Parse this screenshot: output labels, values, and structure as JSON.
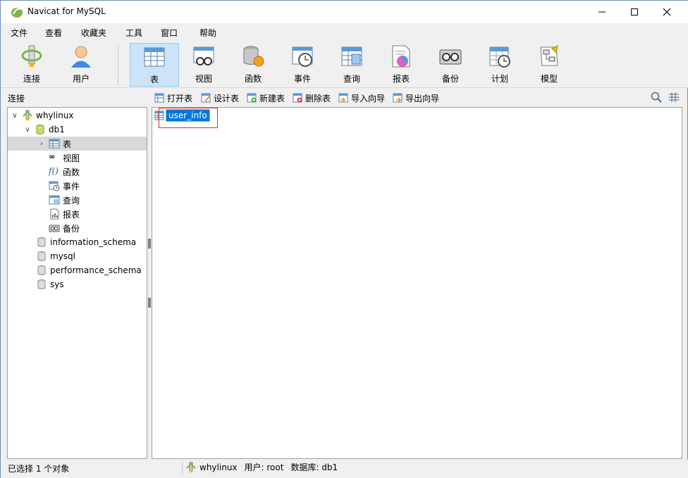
{
  "window": {
    "title": "Navicat for MySQL"
  },
  "menu": [
    "文件",
    "查看",
    "收藏夹",
    "工具",
    "窗口",
    "帮助"
  ],
  "toolbar": [
    {
      "label": "连接",
      "icon": "connection-icon"
    },
    {
      "label": "用户",
      "icon": "user-icon"
    },
    {
      "label": "表",
      "icon": "table-icon",
      "active": true
    },
    {
      "label": "视图",
      "icon": "view-icon"
    },
    {
      "label": "函数",
      "icon": "function-icon"
    },
    {
      "label": "事件",
      "icon": "event-icon"
    },
    {
      "label": "查询",
      "icon": "query-icon"
    },
    {
      "label": "报表",
      "icon": "report-icon"
    },
    {
      "label": "备份",
      "icon": "backup-icon"
    },
    {
      "label": "计划",
      "icon": "schedule-icon"
    },
    {
      "label": "模型",
      "icon": "model-icon"
    }
  ],
  "left_header": "连接",
  "object_toolbar": [
    "打开表",
    "设计表",
    "新建表",
    "删除表",
    "导入向导",
    "导出向导"
  ],
  "tree": {
    "connection": "whylinux",
    "database": "db1",
    "db_children": [
      "表",
      "视图",
      "函数",
      "事件",
      "查询",
      "报表",
      "备份"
    ],
    "other_databases": [
      "information_schema",
      "mysql",
      "performance_schema",
      "sys"
    ]
  },
  "tables": [
    "user_info"
  ],
  "status": {
    "selection": "已选择 1 个对象",
    "connection": "whylinux",
    "user": "用户: root",
    "database": "数据库: db1"
  },
  "colors": {
    "selection": "#0078d7",
    "highlight_box": "#e03030",
    "active_tool": "#cce4f7"
  }
}
